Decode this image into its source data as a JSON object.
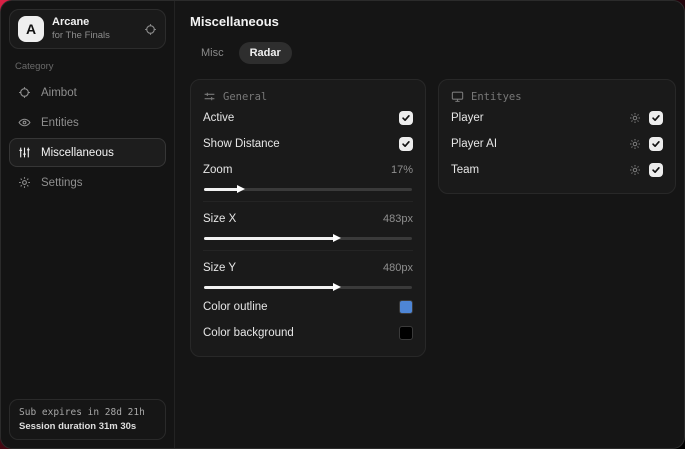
{
  "colors": {
    "accent_red": "#d92045",
    "checkbox_bg": "#ededed",
    "outline_swatch": "#4e86d6",
    "background_swatch": "#000000"
  },
  "sidebar": {
    "brand": {
      "initial": "A",
      "name": "Arcane",
      "subtitle": "for The Finals"
    },
    "category_label": "Category",
    "items": [
      {
        "label": "Aimbot",
        "icon": "crosshair-icon",
        "active": false
      },
      {
        "label": "Entities",
        "icon": "eye-icon",
        "active": false
      },
      {
        "label": "Miscellaneous",
        "icon": "sliders-icon",
        "active": true
      },
      {
        "label": "Settings",
        "icon": "gear-icon",
        "active": false
      }
    ],
    "session": {
      "line1": "Sub expires in 28d 21h",
      "line2": "Session duration 31m 30s"
    }
  },
  "main": {
    "title": "Miscellaneous",
    "tabs": [
      {
        "label": "Misc",
        "active": false
      },
      {
        "label": "Radar",
        "active": true
      }
    ],
    "general": {
      "title": "General",
      "toggles": [
        {
          "label": "Active",
          "checked": true
        },
        {
          "label": "Show Distance",
          "checked": true
        }
      ],
      "sliders": [
        {
          "label": "Zoom",
          "value": "17%",
          "percent": 17
        },
        {
          "label": "Size X",
          "value": "483px",
          "percent": 63
        },
        {
          "label": "Size Y",
          "value": "480px",
          "percent": 63
        }
      ],
      "swatches": [
        {
          "label": "Color outline",
          "color": "#4e86d6"
        },
        {
          "label": "Color background",
          "color": "#000000"
        }
      ]
    },
    "entities": {
      "title": "Entityes",
      "rows": [
        {
          "label": "Player",
          "checked": true
        },
        {
          "label": "Player AI",
          "checked": true
        },
        {
          "label": "Team",
          "checked": true
        }
      ]
    }
  }
}
